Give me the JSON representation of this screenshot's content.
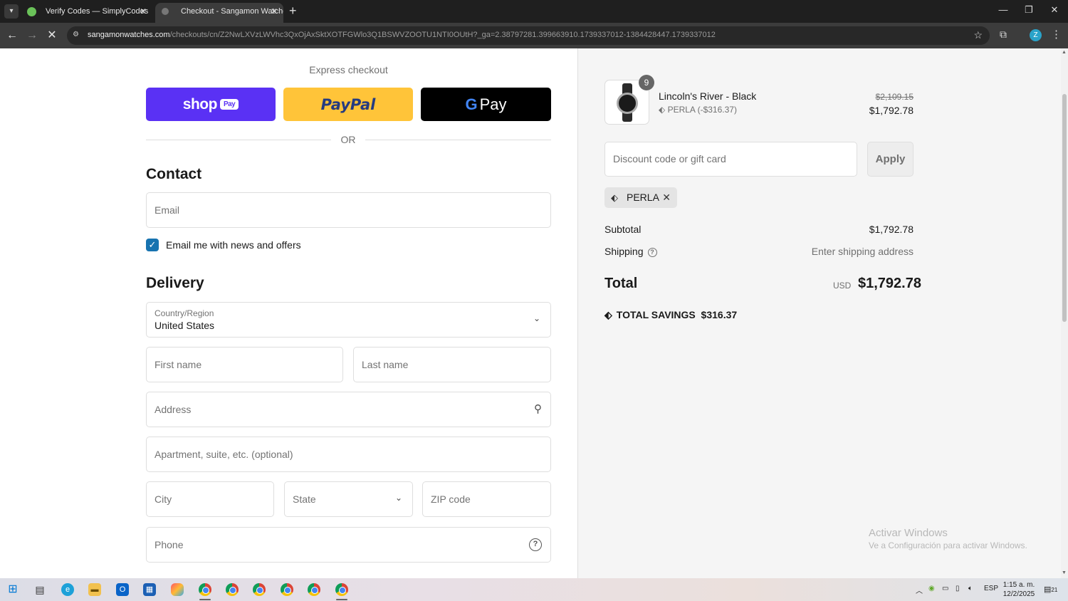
{
  "browser": {
    "tabs": [
      {
        "title": "Verify Codes — SimplyCodes",
        "active": false
      },
      {
        "title": "Checkout - Sangamon Watches",
        "active": true
      }
    ],
    "url_host": "sangamonwatches.com",
    "url_path": "/checkouts/cn/Z2NwLXVzLWVhc3QxOjAxSktXOTFGWlo3Q1BSWVZOOTU1NTI0OUtH?_ga=2.38797281.399663910.1739337012-1384428447.1739337012",
    "profile_initial": "Z"
  },
  "express": {
    "title": "Express checkout",
    "shop_label": "shop",
    "shop_badge": "Pay",
    "paypal_label": "PayPal",
    "gpay_g": "G",
    "gpay_label": "Pay",
    "or_label": "OR"
  },
  "contact": {
    "title": "Contact",
    "email_placeholder": "Email",
    "newsletter_label": "Email me with news and offers",
    "newsletter_checked": true
  },
  "delivery": {
    "title": "Delivery",
    "country_label": "Country/Region",
    "country_value": "United States",
    "first_name": "First name",
    "last_name": "Last name",
    "address": "Address",
    "apartment": "Apartment, suite, etc. (optional)",
    "city": "City",
    "state": "State",
    "zip": "ZIP code",
    "phone": "Phone"
  },
  "summary": {
    "product": {
      "name": "Lincoln's River - Black",
      "quantity": "9",
      "discount_line": "PERLA (-$316.37)",
      "price_original": "$2,109.15",
      "price_final": "$1,792.78"
    },
    "discount_placeholder": "Discount code or gift card",
    "apply_label": "Apply",
    "applied_code": "PERLA",
    "subtotal_label": "Subtotal",
    "subtotal_value": "$1,792.78",
    "shipping_label": "Shipping",
    "shipping_value": "Enter shipping address",
    "total_label": "Total",
    "currency": "USD",
    "total_value": "$1,792.78",
    "savings_label": "TOTAL SAVINGS",
    "savings_value": "$316.37"
  },
  "watermark": {
    "line1": "Activar Windows",
    "line2": "Ve a Configuración para activar Windows."
  },
  "taskbar": {
    "language": "ESP",
    "time": "1:15 a. m.",
    "date": "12/2/2025",
    "notifications": "21"
  },
  "colors": {
    "shop_pay": "#5a31f4",
    "paypal": "#ffc439",
    "gpay": "#000000",
    "checkbox": "#1773b0"
  }
}
